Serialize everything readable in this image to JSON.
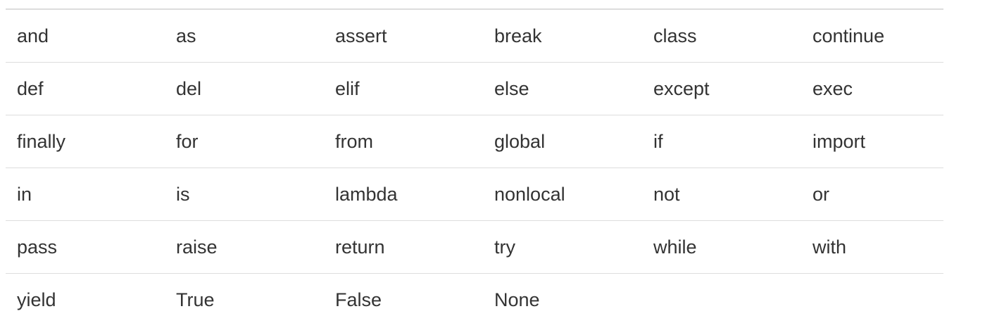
{
  "keywords_table": {
    "rows": [
      [
        "and",
        "as",
        "assert",
        "break",
        "class",
        "continue"
      ],
      [
        "def",
        "del",
        "elif",
        "else",
        "except",
        "exec"
      ],
      [
        "finally",
        "for",
        "from",
        "global",
        "if",
        "import"
      ],
      [
        "in",
        "is",
        "lambda",
        "nonlocal",
        "not",
        "or"
      ],
      [
        "pass",
        "raise",
        "return",
        "try",
        "while",
        "with"
      ],
      [
        "yield",
        "True",
        "False",
        "None",
        "",
        ""
      ]
    ]
  }
}
